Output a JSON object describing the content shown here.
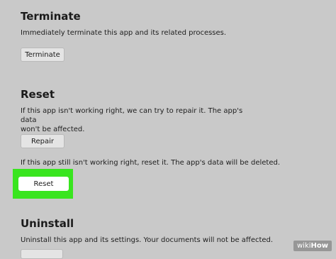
{
  "terminate": {
    "title": "Terminate",
    "description": "Immediately terminate this app and its related processes.",
    "button_label": "Terminate"
  },
  "reset": {
    "title": "Reset",
    "repair_description_line1": "If this app isn't working right, we can try to repair it. The app's data",
    "repair_description_line2": "won't be affected.",
    "repair_button_label": "Repair",
    "reset_description": "If this app still isn't working right, reset it. The app's data will be deleted.",
    "reset_button_label": "Reset",
    "highlight_color": "#39e51f"
  },
  "uninstall": {
    "title": "Uninstall",
    "description": "Uninstall this app and its settings. Your documents will not be affected."
  },
  "watermark": {
    "prefix": "wiki",
    "suffix": "How"
  }
}
